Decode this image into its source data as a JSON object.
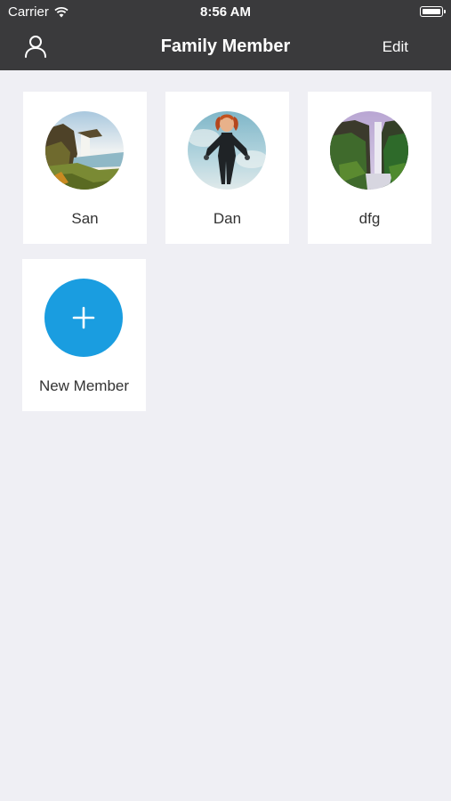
{
  "status_bar": {
    "carrier": "Carrier",
    "time": "8:56 AM"
  },
  "nav": {
    "title": "Family Member",
    "edit_label": "Edit",
    "profile_icon": "person-icon"
  },
  "members": [
    {
      "name": "San",
      "avatar": "waterfall-landscape-photo"
    },
    {
      "name": "Dan",
      "avatar": "superhero-woman-photo"
    },
    {
      "name": "dfg",
      "avatar": "waterfall-cliff-photo"
    }
  ],
  "add_member": {
    "label": "New Member",
    "icon": "plus-icon"
  },
  "colors": {
    "nav_background": "#3a3a3c",
    "page_background": "#efeff4",
    "accent": "#1a9de0"
  }
}
